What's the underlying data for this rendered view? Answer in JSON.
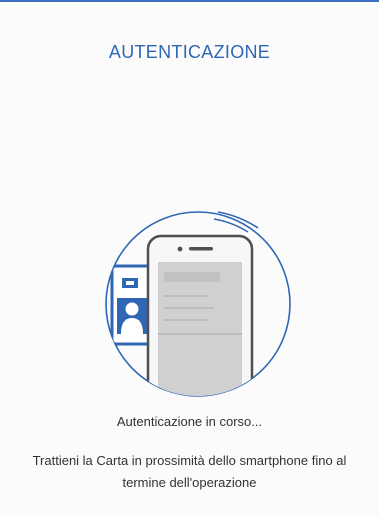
{
  "header": {
    "title": "AUTENTICAZIONE"
  },
  "status": {
    "text": "Autenticazione in corso..."
  },
  "instruction": {
    "text": "Trattieni la Carta in prossimità dello smartphone fino al termine dell'operazione"
  },
  "illustration": {
    "icon": "phone-card-nfc-icon"
  },
  "colors": {
    "accent": "#2f67b4",
    "rule": "#3a6fc0",
    "background": "#fbfbfb",
    "text": "#333333"
  }
}
